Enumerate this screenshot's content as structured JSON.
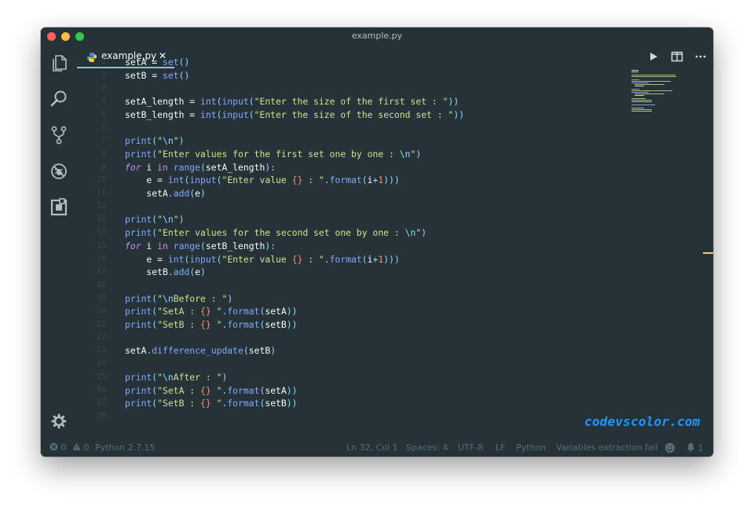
{
  "window": {
    "title": "example.py"
  },
  "tab": {
    "label": "example.py",
    "close": "✕"
  },
  "code_lines": [
    {
      "n": "1",
      "html": "setA = <span class='f'>set</span><span class='p'>()</span>"
    },
    {
      "n": "2",
      "html": "setB = <span class='f'>set</span><span class='p'>()</span>"
    },
    {
      "n": "3",
      "html": ""
    },
    {
      "n": "4",
      "html": "setA_length = <span class='f'>int</span><span class='p'>(</span><span class='f'>input</span><span class='p'>(</span><span class='s'>\"Enter the size of the first set : \"</span><span class='p'>))</span>"
    },
    {
      "n": "5",
      "html": "setB_length = <span class='f'>int</span><span class='p'>(</span><span class='f'>input</span><span class='p'>(</span><span class='s'>\"Enter the size of the second set : \"</span><span class='p'>))</span>"
    },
    {
      "n": "6",
      "html": ""
    },
    {
      "n": "7",
      "html": "<span class='f'>print</span><span class='p'>(</span><span class='s'>\"</span><span class='p'>\\n</span><span class='s'>\"</span><span class='p'>)</span>"
    },
    {
      "n": "8",
      "html": "<span class='f'>print</span><span class='p'>(</span><span class='s'>\"Enter values for the first set one by one : </span><span class='p'>\\n</span><span class='s'>\"</span><span class='p'>)</span>"
    },
    {
      "n": "9",
      "html": "<span class='k'>for</span> i <span class='kw'>in</span> <span class='f'>range</span><span class='p'>(</span>setA_length<span class='p'>):</span>"
    },
    {
      "n": "10",
      "html": "    e = <span class='f'>int</span><span class='p'>(</span><span class='f'>input</span><span class='p'>(</span><span class='s'>\"Enter value </span><span class='o'>{}</span><span class='s'> : \"</span><span class='p'>.</span><span class='f'>format</span><span class='p'>(</span>i<span class='p'>+</span><span class='o'>1</span><span class='p'>)))</span>"
    },
    {
      "n": "11",
      "html": "    setA<span class='p'>.</span><span class='f'>add</span><span class='p'>(</span>e<span class='p'>)</span>"
    },
    {
      "n": "12",
      "html": ""
    },
    {
      "n": "13",
      "html": "<span class='f'>print</span><span class='p'>(</span><span class='s'>\"</span><span class='p'>\\n</span><span class='s'>\"</span><span class='p'>)</span>"
    },
    {
      "n": "14",
      "html": "<span class='f'>print</span><span class='p'>(</span><span class='s'>\"Enter values for the second set one by one : </span><span class='p'>\\n</span><span class='s'>\"</span><span class='p'>)</span>"
    },
    {
      "n": "15",
      "html": "<span class='k'>for</span> i <span class='kw'>in</span> <span class='f'>range</span><span class='p'>(</span>setB_length<span class='p'>):</span>"
    },
    {
      "n": "16",
      "html": "    e = <span class='f'>int</span><span class='p'>(</span><span class='f'>input</span><span class='p'>(</span><span class='s'>\"Enter value </span><span class='o'>{}</span><span class='s'> : \"</span><span class='p'>.</span><span class='f'>format</span><span class='p'>(</span>i<span class='p'>+</span><span class='o'>1</span><span class='p'>)))</span>"
    },
    {
      "n": "17",
      "html": "    setB<span class='p'>.</span><span class='f'>add</span><span class='p'>(</span>e<span class='p'>)</span>"
    },
    {
      "n": "18",
      "html": ""
    },
    {
      "n": "19",
      "html": "<span class='f'>print</span><span class='p'>(</span><span class='s'>\"</span><span class='p'>\\n</span><span class='s'>Before : \"</span><span class='p'>)</span>"
    },
    {
      "n": "20",
      "html": "<span class='f'>print</span><span class='p'>(</span><span class='s'>\"SetA : </span><span class='o'>{}</span><span class='s'> \"</span><span class='p'>.</span><span class='f'>format</span><span class='p'>(</span>setA<span class='p'>))</span>"
    },
    {
      "n": "21",
      "html": "<span class='f'>print</span><span class='p'>(</span><span class='s'>\"SetB : </span><span class='o'>{}</span><span class='s'> \"</span><span class='p'>.</span><span class='f'>format</span><span class='p'>(</span>setB<span class='p'>))</span>"
    },
    {
      "n": "22",
      "html": ""
    },
    {
      "n": "23",
      "html": "setA<span class='p'>.</span><span class='f'>difference_update</span><span class='p'>(</span>setB<span class='p'>)</span>"
    },
    {
      "n": "24",
      "html": ""
    },
    {
      "n": "25",
      "html": "<span class='f'>print</span><span class='p'>(</span><span class='s'>\"</span><span class='p'>\\n</span><span class='s'>After : \"</span><span class='p'>)</span>"
    },
    {
      "n": "26",
      "html": "<span class='f'>print</span><span class='p'>(</span><span class='s'>\"SetA : </span><span class='o'>{}</span><span class='s'> \"</span><span class='p'>.</span><span class='f'>format</span><span class='p'>(</span>setA<span class='p'>))</span>"
    },
    {
      "n": "27",
      "html": "<span class='f'>print</span><span class='p'>(</span><span class='s'>\"SetB : </span><span class='o'>{}</span><span class='s'> \"</span><span class='p'>.</span><span class='f'>format</span><span class='p'>(</span>setB<span class='p'>))</span>"
    },
    {
      "n": "28",
      "html": ""
    }
  ],
  "watermark": "codevscolor.com",
  "status": {
    "errors": "0",
    "warnings": "0",
    "interpreter": "Python 2.7.15",
    "position": "Ln 32, Col 1",
    "spaces": "Spaces: 4",
    "encoding": "UTF-8",
    "eol": "LF",
    "language": "Python",
    "message": "Variables extraction fail",
    "notifications": "1"
  },
  "icons": {
    "activity": [
      "files-icon",
      "search-icon",
      "source-control-icon",
      "debug-icon",
      "extensions-icon",
      "settings-gear-icon"
    ],
    "tab_actions": [
      "run-icon",
      "split-editor-icon",
      "more-actions-icon"
    ]
  },
  "colors": {
    "background": "#263238",
    "accent": "#80cbc4",
    "string": "#c3e88d",
    "function": "#82aaff",
    "keyword": "#c792ea",
    "number": "#f78c6c",
    "punctuation": "#89ddff",
    "watermark": "#2196f3"
  }
}
